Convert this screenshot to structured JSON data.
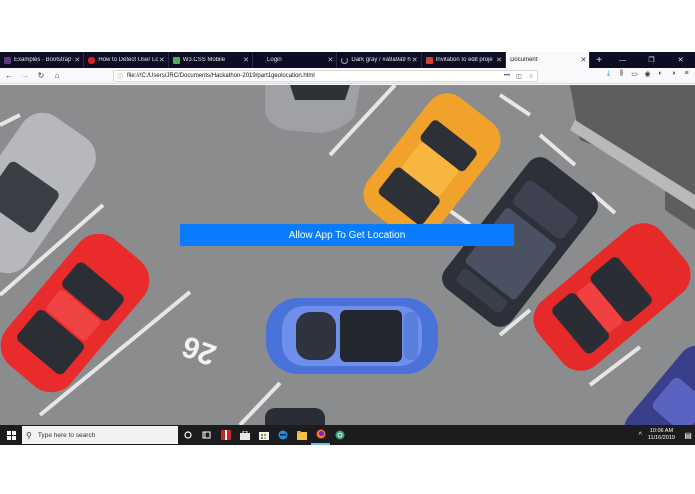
{
  "browser": {
    "tabs": [
      {
        "label": "Examples · Bootstrap",
        "favicon_color": "#563d7c",
        "favicon": "bootstrap-icon",
        "active": false
      },
      {
        "label": "How to Detect User Lo",
        "favicon_color": "#e02020",
        "favicon": "youtube-icon",
        "active": false
      },
      {
        "label": "W3.CSS Mobile",
        "favicon_color": "#4caf50",
        "favicon": "w3schools-icon",
        "active": false
      },
      {
        "label": "Login",
        "favicon_color": "#0c0c23",
        "favicon": "blank-icon",
        "active": false
      },
      {
        "label": "Dark gray / #a9a9a9 he",
        "favicon_color": "#a9a9a9",
        "favicon": "loading-icon",
        "active": false
      },
      {
        "label": "Invitation to edit proje",
        "favicon_color": "#d23f31",
        "favicon": "gmail-icon",
        "active": false
      },
      {
        "label": "Document",
        "favicon_color": "#f9f9fb",
        "favicon": "blank-icon",
        "active": true
      }
    ],
    "new_tab_label": "+",
    "url": "file:///C:/Users/JRC/Documents/Hackathon-2019/part1geolocation.html",
    "page_actions_label": "•••"
  },
  "page": {
    "allow_button_label": "Allow App To Get Location",
    "parking_spot_number": "26"
  },
  "taskbar": {
    "search_placeholder": "Type here to search",
    "time": "10:06 AM",
    "date": "11/16/2019"
  },
  "colors": {
    "button_blue": "#0a7cff",
    "tabbar_bg": "#0c0c23",
    "taskbar_bg": "#1c1c1e",
    "asphalt": "#8b8c8e"
  }
}
